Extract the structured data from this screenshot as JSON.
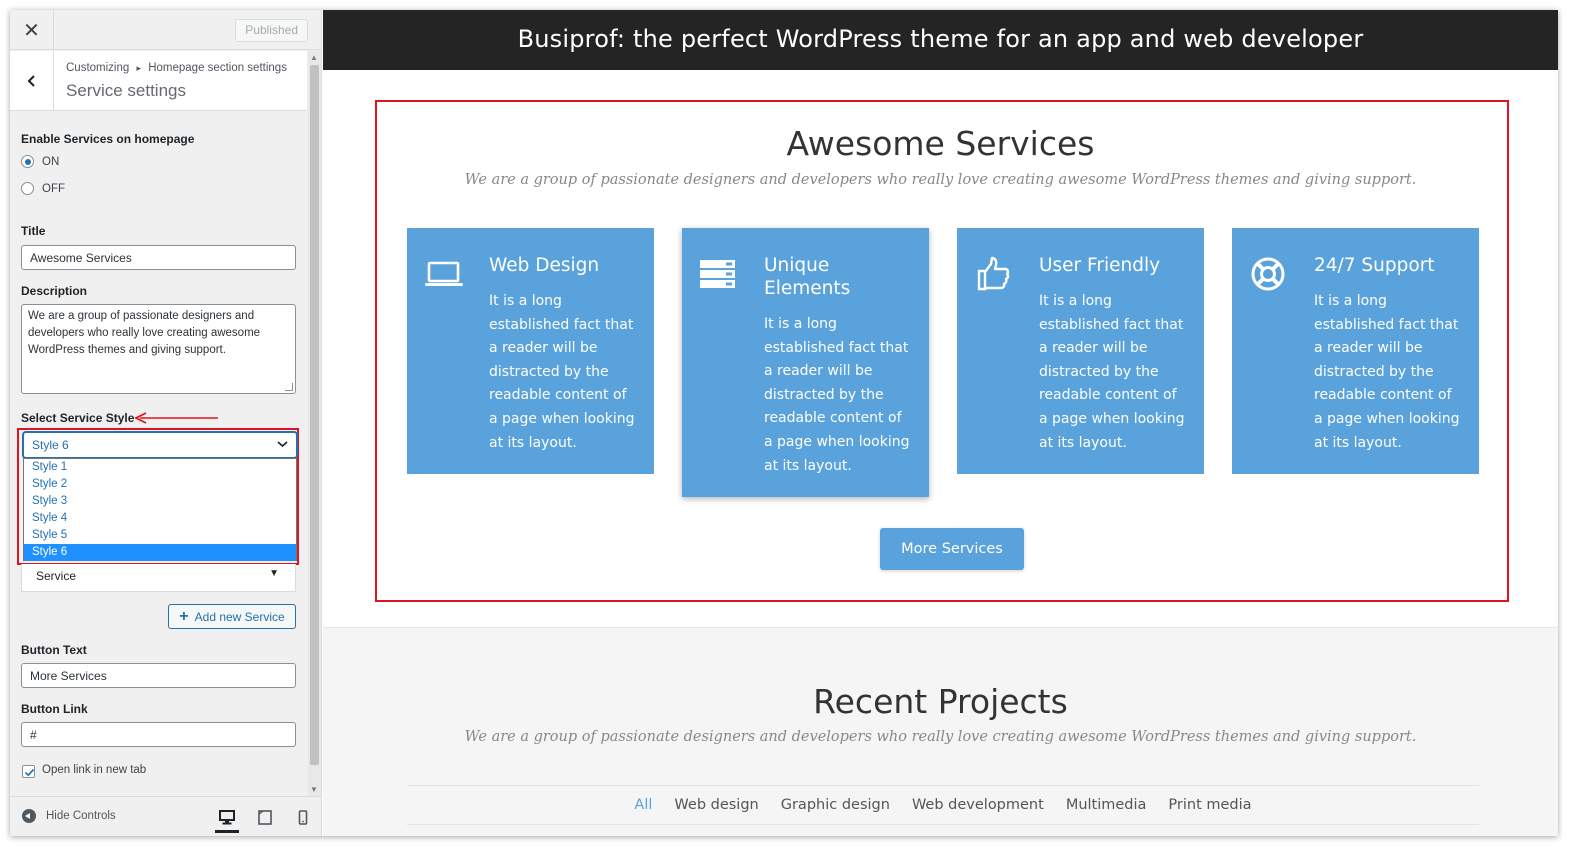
{
  "sidebar": {
    "close_label": "✕",
    "published_label": "Published",
    "breadcrumb_root": "Customizing",
    "breadcrumb_sep": "▸",
    "breadcrumb_section": "Homepage section settings",
    "section_title": "Service settings",
    "enable_label": "Enable Services on homepage",
    "radio_on": "ON",
    "radio_off": "OFF",
    "title_label": "Title",
    "title_value": "Awesome Services",
    "description_label": "Description",
    "description_value": "We are a group of passionate designers and developers who really love creating awesome WordPress themes and giving support.",
    "style_label": "Select Service Style",
    "style_selected": "Style 6",
    "style_options": [
      "Style 1",
      "Style 2",
      "Style 3",
      "Style 4",
      "Style 5",
      "Style 6"
    ],
    "service_item_label": "Service",
    "add_service_label": "Add new Service",
    "button_text_label": "Button Text",
    "button_text_value": "More Services",
    "button_link_label": "Button Link",
    "button_link_value": "#",
    "new_tab_label": "Open link in new tab",
    "hide_controls_label": "Hide Controls"
  },
  "preview": {
    "banner": "Busiprof: the perfect WordPress theme for an app and web developer",
    "services_title": "Awesome Services",
    "services_subtitle": "We are a group of passionate designers and developers who really love creating awesome WordPress themes and giving support.",
    "cards": [
      {
        "title": "Web Design",
        "text": "It is a long established fact that a reader will be distracted by the readable content of a page when looking at its layout.",
        "icon": "laptop-icon"
      },
      {
        "title": "Unique Elements",
        "text": "It is a long established fact that a reader will be distracted by the readable content of a page when looking at its layout.",
        "icon": "server-icon"
      },
      {
        "title": "User Friendly",
        "text": "It is a long established fact that a reader will be distracted by the readable content of a page when looking at its layout.",
        "icon": "thumbs-up-icon"
      },
      {
        "title": "24/7 Support",
        "text": "It is a long established fact that a reader will be distracted by the readable content of a page when looking at its layout.",
        "icon": "life-ring-icon"
      }
    ],
    "more_services_label": "More Services",
    "projects_title": "Recent Projects",
    "projects_subtitle": "We are a group of passionate designers and developers who really love creating awesome WordPress themes and giving support.",
    "filters": [
      "All",
      "Web design",
      "Graphic design",
      "Web development",
      "Multimedia",
      "Print media"
    ]
  },
  "colors": {
    "accent": "#5aa2dc",
    "wp_blue": "#2271b1",
    "highlight_red": "#e0141e",
    "banner_bg": "#242424"
  }
}
